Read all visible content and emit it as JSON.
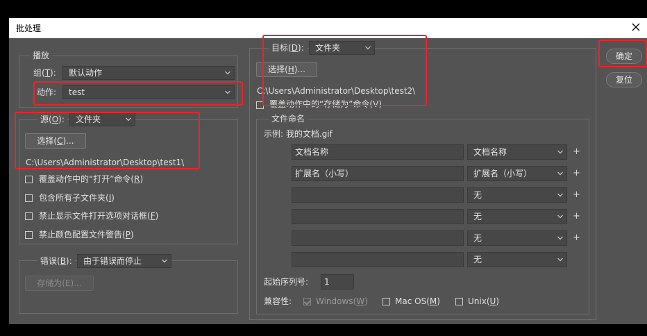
{
  "dialog": {
    "title": "批处理",
    "close_label": "×"
  },
  "play": {
    "legend": "播放",
    "group_label": "组(",
    "group_key": "T",
    "group_tail": "):",
    "group_value": "默认动作",
    "action_label": "动作:",
    "action_value": "test"
  },
  "source": {
    "label": "源(",
    "key": "O",
    "tail": "):",
    "value": "文件夹",
    "choose_label": "选择(",
    "choose_key": "C",
    "choose_tail": ")...",
    "path": "C:\\Users\\Administrator\\Desktop\\test1\\",
    "options": [
      {
        "text": "覆盖动作中的“打开”命令(",
        "key": "R",
        "tail": ")",
        "checked": false
      },
      {
        "text": "包含所有子文件夹(",
        "key": "I",
        "tail": ")",
        "checked": false
      },
      {
        "text": "禁止显示文件打开选项对话框(",
        "key": "F",
        "tail": ")",
        "checked": false
      },
      {
        "text": "禁止颜色配置文件警告(",
        "key": "P",
        "tail": ")",
        "checked": false
      }
    ]
  },
  "errors": {
    "label": "错误(",
    "key": "B",
    "tail": "):",
    "value": "由于错误而停止",
    "saveas_label": "存储为(E)..."
  },
  "target": {
    "label": "目标(",
    "key": "D",
    "tail": "):",
    "value": "文件夹",
    "choose_label": "选择(",
    "choose_key": "H",
    "choose_tail": ")...",
    "path": "C:\\Users\\Administrator\\Desktop\\test2\\",
    "override_label": "覆盖动作中的“存储为”命令(V)"
  },
  "naming": {
    "legend": "文件命名",
    "example": "示例: 我的文档.gif",
    "rows": [
      {
        "field": "文档名称",
        "select": "文档名称",
        "plus": "+"
      },
      {
        "field": "扩展名（小写）",
        "select": "扩展名（小写）",
        "plus": "+"
      },
      {
        "field": "",
        "select": "无",
        "plus": "+"
      },
      {
        "field": "",
        "select": "无",
        "plus": "+"
      },
      {
        "field": "",
        "select": "无",
        "plus": "+"
      },
      {
        "field": "",
        "select": "无",
        "plus": ""
      }
    ],
    "serial_label": "起始序列号:",
    "serial_value": "1",
    "compat_label": "兼容性:",
    "compat": [
      {
        "text": "Windows(",
        "key": "W",
        "tail": ")",
        "checked": true,
        "disabled": true
      },
      {
        "text": "Mac OS(",
        "key": "M",
        "tail": ")",
        "checked": false,
        "disabled": false
      },
      {
        "text": "Unix(",
        "key": "U",
        "tail": ")",
        "checked": false,
        "disabled": false
      }
    ]
  },
  "buttons": {
    "ok": "确定",
    "reset": "复位"
  },
  "colors": {
    "highlight": "#e8262b",
    "panel": "#535353"
  }
}
